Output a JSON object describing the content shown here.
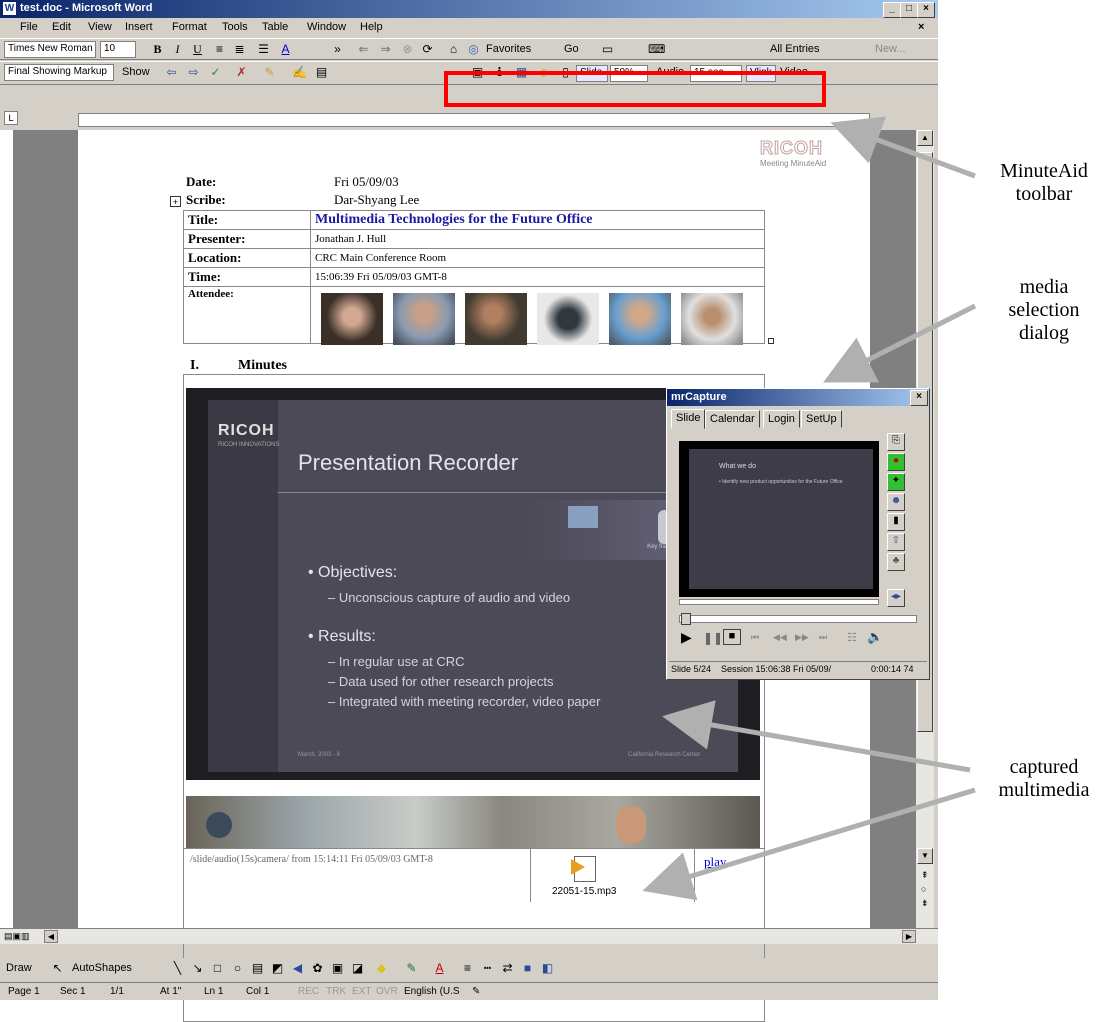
{
  "window": {
    "title": "test.doc - Microsoft Word"
  },
  "menu": [
    "File",
    "Edit",
    "View",
    "Insert",
    "Format",
    "Tools",
    "Table",
    "Window",
    "Help"
  ],
  "formatting": {
    "font": "Times New Roman",
    "size": "10",
    "favorites": "Favorites",
    "go": "Go",
    "style_box": "All Entries",
    "new": "New..."
  },
  "review": {
    "markup": "Final Showing Markup",
    "show": "Show"
  },
  "minuteaid": {
    "slide": "Slide",
    "zoom": "50%",
    "audio": "Audio",
    "audio_len": "15 sec",
    "vlink": "Vlink",
    "video": "Video"
  },
  "document": {
    "logo": "RICOH",
    "logo_sub": "Meeting MinuteAid",
    "date_label": "Date:",
    "date_value": "Fri 05/09/03",
    "scribe_label": "Scribe:",
    "scribe_value": "Dar-Shyang Lee",
    "title_label": "Title:",
    "title_value": "Multimedia Technologies for the Future Office",
    "presenter_label": "Presenter:",
    "presenter_value": "Jonathan J. Hull",
    "location_label": "Location:",
    "location_value": "CRC Main Conference Room",
    "time_label": "Time:",
    "time_value": "15:06:39 Fri 05/09/03 GMT-8",
    "attendee_label": "Attendee:",
    "section_num": "I.",
    "section_title": "Minutes",
    "slide": {
      "logo": "RICOH",
      "logo_sub": "RICOH INNOVATIONS",
      "title": "Presentation Recorder",
      "key_formats": "Key frames + audio",
      "bullet1": "Objectives:",
      "sub1": "– Unconscious capture of audio and video",
      "bullet2": "Results:",
      "sub2a": "– In regular use at CRC",
      "sub2b": "– Data used for other research projects",
      "sub2c": "– Integrated with meeting recorder, video paper",
      "footer_left": "March, 2003 - 6",
      "footer_right": "California Research Center"
    },
    "caption": "/slide/audio(15s)camera/ from 15:14:11 Fri 05/09/03 GMT-8",
    "mp3": "22051-15.mp3",
    "play": "play"
  },
  "mrcapture": {
    "title": "mrCapture",
    "tabs": [
      "Slide",
      "Calendar",
      "Login",
      "SetUp"
    ],
    "status_slide": "Slide 5/24",
    "status_session": "Session 15:06:38 Fri 05/09/",
    "status_time": "0:00:14 74",
    "preview": {
      "title": "What we do",
      "bullet": "• Identify new product opportunities for the Future Office"
    }
  },
  "draw": {
    "draw": "Draw",
    "autoshapes": "AutoShapes"
  },
  "status": {
    "page": "Page 1",
    "sec": "Sec 1",
    "pages": "1/1",
    "at": "At 1\"",
    "ln": "Ln 1",
    "col": "Col 1",
    "rec": "REC",
    "trk": "TRK",
    "ext": "EXT",
    "ovr": "OVR",
    "lang": "English (U.S"
  },
  "annotations": {
    "toolbar": [
      "MinuteAid",
      "toolbar"
    ],
    "media": [
      "media",
      "selection",
      "dialog"
    ],
    "captured": [
      "captured",
      "multimedia"
    ]
  },
  "colors": {
    "highlight": "#ff0000",
    "title_blue": "#1a1aa0",
    "arrow": "#b0b0b0"
  }
}
